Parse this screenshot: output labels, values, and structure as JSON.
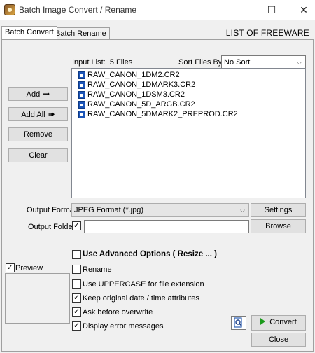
{
  "window": {
    "title": "Batch Image Convert / Rename",
    "controls": {
      "minimize": "—",
      "maximize": "☐",
      "close": "✕"
    }
  },
  "tabs": [
    {
      "label": "Batch Convert",
      "active": true
    },
    {
      "label": "Batch Rename",
      "active": false
    }
  ],
  "brand": "LIST OF FREEWARE",
  "input_list": {
    "label": "Input List:",
    "count": "5 Files",
    "files": [
      "RAW_CANON_1DM2.CR2",
      "RAW_CANON_1DMARK3.CR2",
      "RAW_CANON_1DSM3.CR2",
      "RAW_CANON_5D_ARGB.CR2",
      "RAW_CANON_5DMARK2_PREPROD.CR2"
    ]
  },
  "sort": {
    "label": "Sort Files By:",
    "value": "No Sort"
  },
  "buttons": {
    "add": "Add",
    "add_all": "Add All",
    "remove": "Remove",
    "clear": "Clear",
    "settings": "Settings",
    "browse": "Browse",
    "convert": "Convert",
    "close": "Close"
  },
  "output": {
    "format_label": "Output Format:",
    "format_value": "JPEG Format (*.jpg)",
    "folder_label": "Output Folder:",
    "folder_checked": true,
    "folder_value": ""
  },
  "options": {
    "advanced": {
      "label": "Use Advanced Options ( Resize ... )",
      "checked": false
    },
    "rename": {
      "label": "Rename",
      "checked": false
    },
    "uppercase": {
      "label": "Use UPPERCASE for file extension",
      "checked": false
    },
    "keep_date": {
      "label": "Keep original date / time attributes",
      "checked": true
    },
    "ask_overwrite": {
      "label": "Ask before overwrite",
      "checked": true
    },
    "display_errors": {
      "label": "Display error messages",
      "checked": true
    }
  },
  "preview": {
    "label": "Preview",
    "checked": true
  }
}
